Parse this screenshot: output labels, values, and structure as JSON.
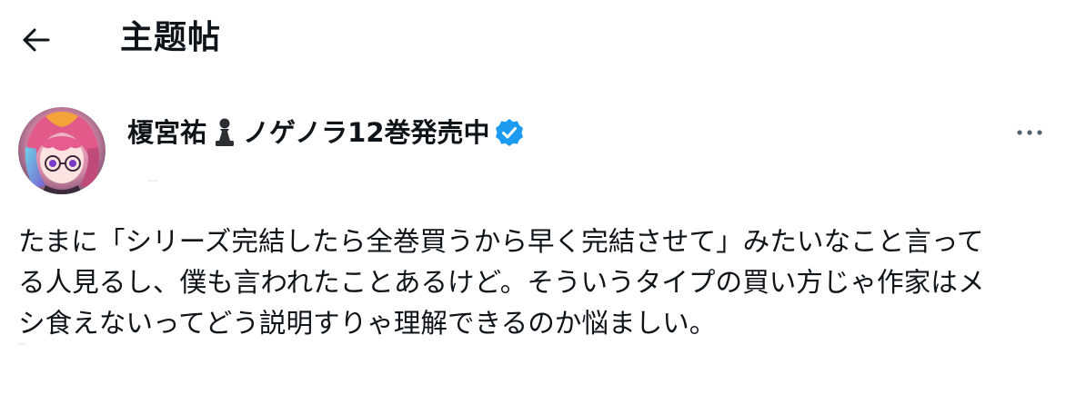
{
  "header": {
    "title": "主题帖",
    "back_icon": "arrow-left-icon"
  },
  "author": {
    "name_prefix": "榎宮祐",
    "name_suffix": "ノゲノラ12巻発売中",
    "badge_icon": "chess-pawn-icon",
    "verified_icon": "verified-badge-icon",
    "verified_color": "#1d9bf0"
  },
  "more_icon": "more-horizontal-icon",
  "tweet": {
    "lines": [
      "たまに「シリーズ完結したら全巻買うから早く完結させて」みたいなこと言って",
      "る人見るし、僕も言われたことあるけど。そういうタイプの買い方じゃ作家はメ",
      "シ食えないってどう説明すりゃ理解できるのか悩ましい。"
    ]
  },
  "colors": {
    "text": "#0f1419",
    "muted": "#536471",
    "accent": "#1d9bf0",
    "background": "#ffffff"
  }
}
